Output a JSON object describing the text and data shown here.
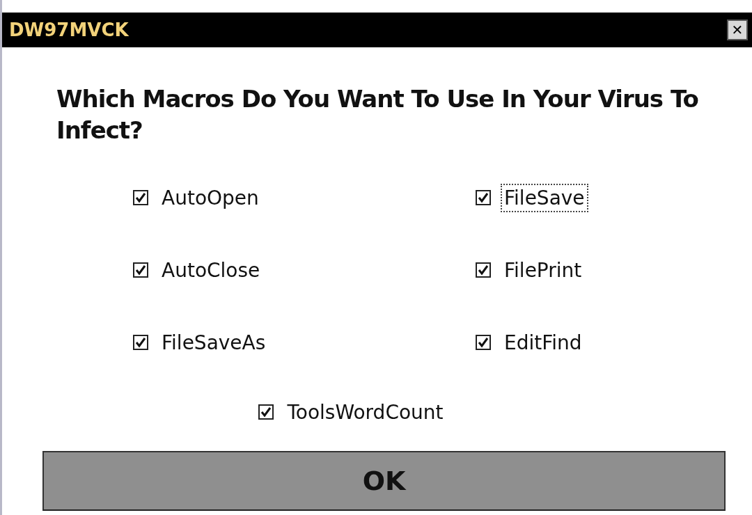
{
  "window": {
    "title": "DW97MVCK",
    "close": "✕"
  },
  "heading": "Which Macros Do You Want To Use In Your Virus To Infect?",
  "options": [
    {
      "label": "AutoOpen",
      "checked": true,
      "focused": false
    },
    {
      "label": "FileSave",
      "checked": true,
      "focused": true
    },
    {
      "label": "AutoClose",
      "checked": true,
      "focused": false
    },
    {
      "label": "FilePrint",
      "checked": true,
      "focused": false
    },
    {
      "label": "FileSaveAs",
      "checked": true,
      "focused": false
    },
    {
      "label": "EditFind",
      "checked": true,
      "focused": false
    },
    {
      "label": "ToolsWordCount",
      "checked": true,
      "focused": false
    }
  ],
  "buttons": [
    "OK"
  ]
}
